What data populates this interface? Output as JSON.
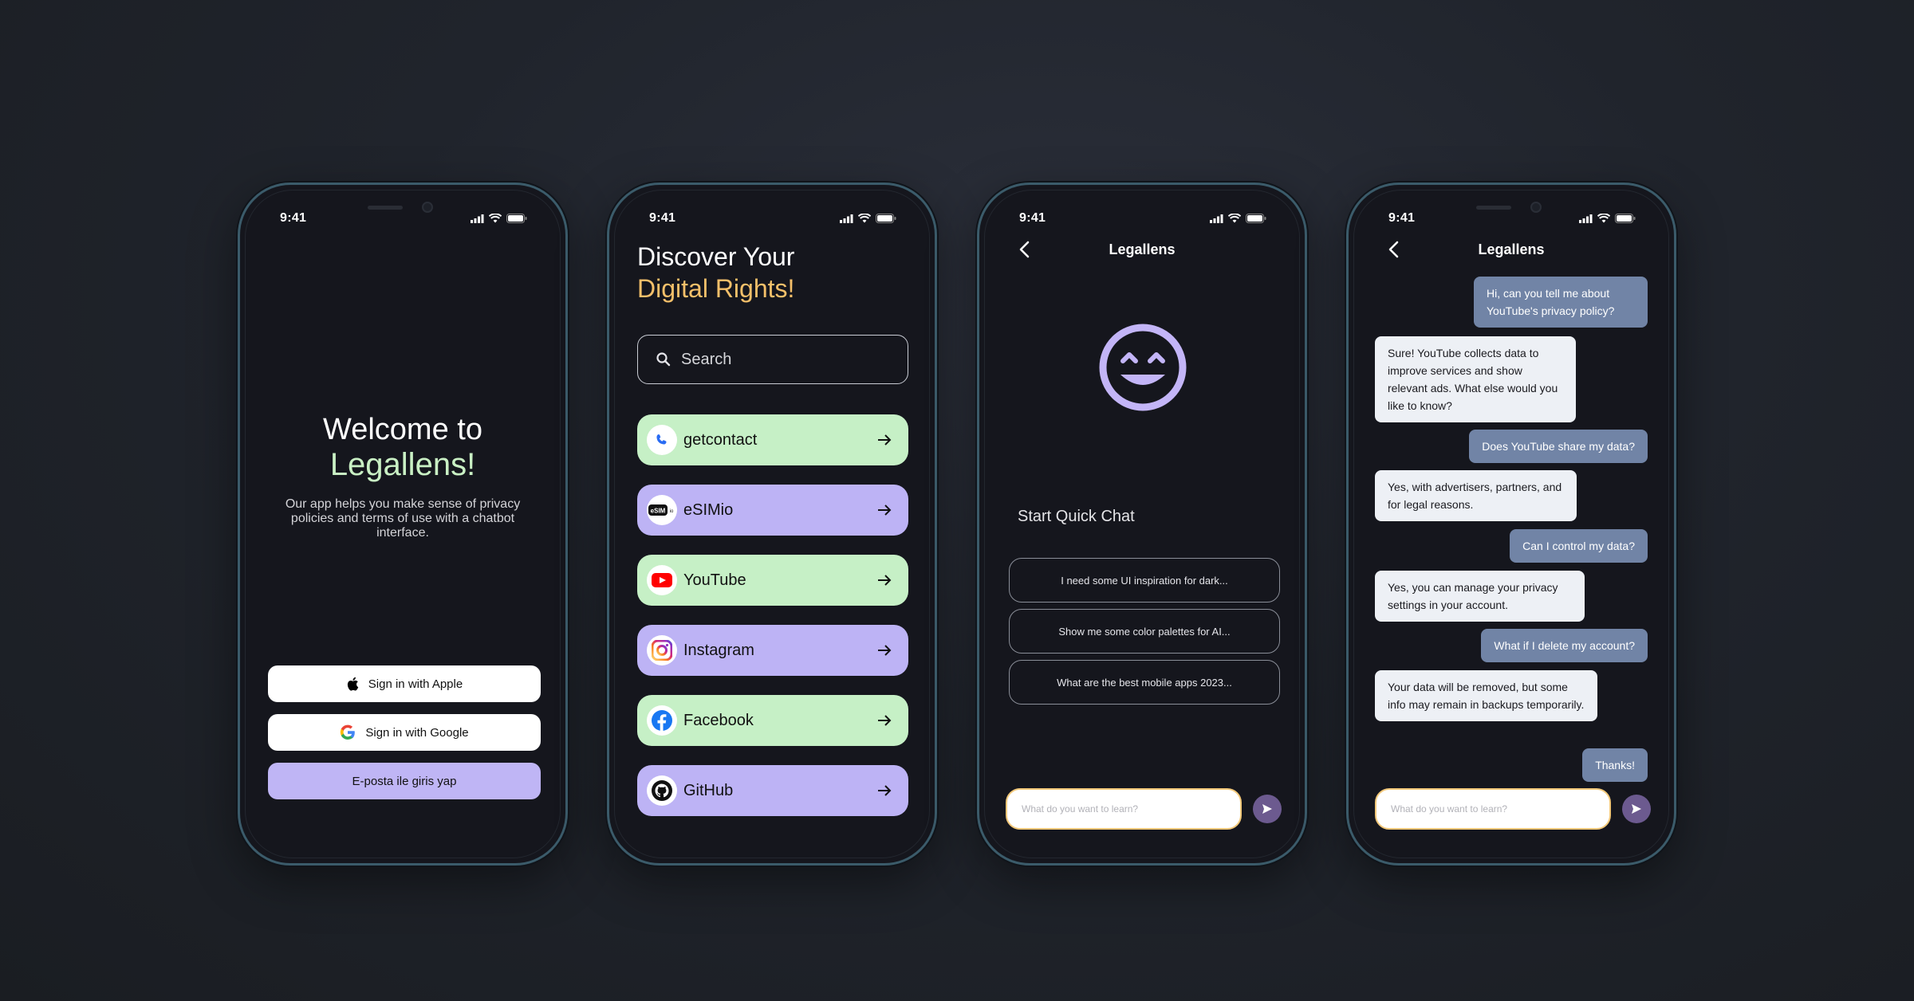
{
  "status": {
    "time": "9:41"
  },
  "phone1": {
    "title": "Welcome to",
    "brand": "Legallens!",
    "description": "Our app helps you make sense of privacy policies and terms of use with a chatbot interface.",
    "apple_label": "Sign in with Apple",
    "google_label": "Sign in with Google",
    "email_label": "E-posta ile giris yap"
  },
  "phone2": {
    "heading_line1": "Discover Your",
    "heading_line2": "Digital Rights!",
    "search_placeholder": "Search",
    "apps": [
      {
        "name": "getcontact",
        "icon": "phone-icon"
      },
      {
        "name": "eSIMio",
        "icon": "esim-icon"
      },
      {
        "name": "YouTube",
        "icon": "youtube-icon"
      },
      {
        "name": "Instagram",
        "icon": "instagram-icon"
      },
      {
        "name": "Facebook",
        "icon": "facebook-icon"
      },
      {
        "name": "GitHub",
        "icon": "github-icon"
      }
    ]
  },
  "phone3": {
    "header": "Legallens",
    "quick_title": "Start Quick Chat",
    "quick_prompts": [
      "I need some UI inspiration for dark...",
      "Show me some color palettes for AI...",
      "What are the best mobile apps 2023..."
    ],
    "input_placeholder": "What do you want to learn?"
  },
  "phone4": {
    "header": "Legallens",
    "messages": [
      {
        "role": "user",
        "text": "Hi, can you tell me about YouTube's privacy policy?"
      },
      {
        "role": "bot",
        "text": "Sure! YouTube collects data to improve services and show relevant ads. What else would you like to know?"
      },
      {
        "role": "user",
        "text": "Does YouTube share my data?"
      },
      {
        "role": "bot",
        "text": "Yes, with advertisers, partners, and for legal reasons."
      },
      {
        "role": "user",
        "text": "Can I control my data?"
      },
      {
        "role": "bot",
        "text": "Yes, you can manage your privacy settings in your account."
      },
      {
        "role": "user",
        "text": "What if I delete my account?"
      },
      {
        "role": "bot",
        "text": "Your data will be removed, but some info may remain in backups temporarily."
      },
      {
        "role": "user",
        "text": "Thanks!"
      }
    ],
    "input_placeholder": "What do you want to learn?"
  },
  "colors": {
    "accent_green": "#c6f0c6",
    "accent_purple": "#bdb3f5",
    "accent_gold": "#f5c06a",
    "user_bubble": "#7184a6",
    "bot_bubble": "#edf0f5"
  }
}
